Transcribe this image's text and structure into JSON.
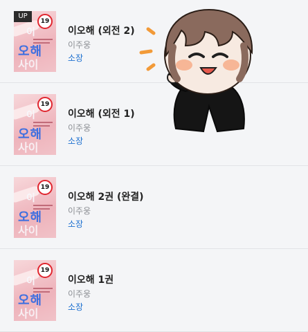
{
  "books": [
    {
      "title": "이오해 (외전 2)",
      "author": "이주웅",
      "status": "소장",
      "badge": "UP",
      "age": "19"
    },
    {
      "title": "이오해 (외전 1)",
      "author": "이주웅",
      "status": "소장",
      "age": "19"
    },
    {
      "title": "이오해 2권 (완결)",
      "author": "이주웅",
      "status": "소장",
      "age": "19"
    },
    {
      "title": "이오해 1권",
      "author": "이주웅",
      "status": "소장",
      "age": "19"
    }
  ],
  "mascot_icon": "chibi-character-illustration"
}
